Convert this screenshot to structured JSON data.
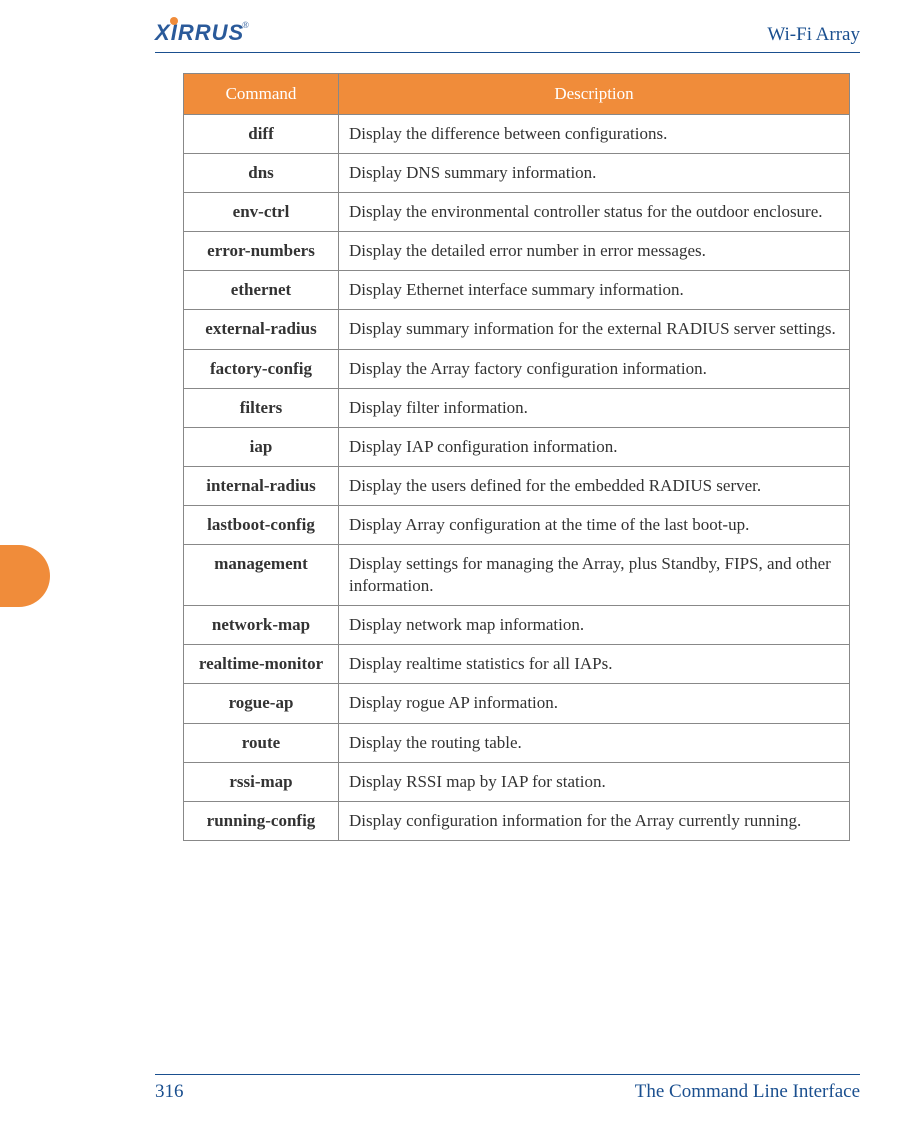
{
  "header": {
    "logo_text": "XIRRUS",
    "title": "Wi-Fi Array"
  },
  "table": {
    "headers": {
      "command": "Command",
      "description": "Description"
    },
    "rows": [
      {
        "command": "diff",
        "description": "Display the difference between configurations."
      },
      {
        "command": "dns",
        "description": "Display DNS summary information."
      },
      {
        "command": "env-ctrl",
        "description": "Display the environmental controller status for the outdoor enclosure."
      },
      {
        "command": "error-numbers",
        "description": "Display the detailed error number in error messages."
      },
      {
        "command": "ethernet",
        "description": "Display Ethernet interface summary information."
      },
      {
        "command": "external-radius",
        "description": "Display summary information for the external RADIUS server settings."
      },
      {
        "command": "factory-config",
        "description": "Display the Array factory configuration information."
      },
      {
        "command": "filters",
        "description": "Display filter information."
      },
      {
        "command": "iap",
        "description": "Display IAP configuration information."
      },
      {
        "command": "internal-radius",
        "description": "Display the users defined for the embedded RADIUS server."
      },
      {
        "command": "lastboot-config",
        "description": "Display Array configuration at the time of the last boot-up."
      },
      {
        "command": "management",
        "description": "Display settings for managing the Array, plus Standby, FIPS, and other information."
      },
      {
        "command": "network-map",
        "description": "Display network map information."
      },
      {
        "command": "realtime-monitor",
        "description": "Display realtime statistics for all IAPs."
      },
      {
        "command": "rogue-ap",
        "description": "Display rogue AP information."
      },
      {
        "command": "route",
        "description": "Display the routing table."
      },
      {
        "command": "rssi-map",
        "description": "Display RSSI map by IAP for station."
      },
      {
        "command": "running-config",
        "description": "Display configuration information for the Array currently running."
      }
    ]
  },
  "footer": {
    "page_number": "316",
    "section_title": "The Command Line Interface"
  }
}
